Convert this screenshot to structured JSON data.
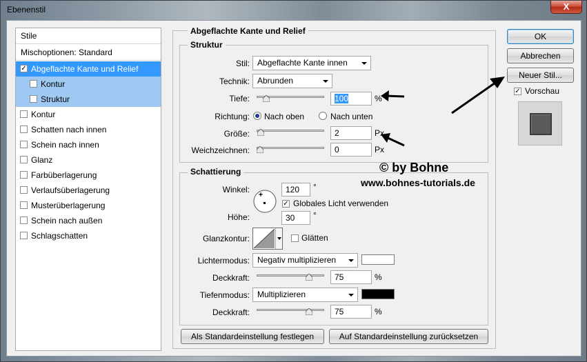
{
  "window": {
    "title": "Ebenenstil",
    "close_label": "X"
  },
  "sidebar": {
    "header": "Stile",
    "blend_options": "Mischoptionen: Standard",
    "items": [
      {
        "label": "Abgeflachte Kante und Relief",
        "checked": true,
        "selected": true
      },
      {
        "label": "Kontur",
        "checked": false,
        "sub": true
      },
      {
        "label": "Struktur",
        "checked": false,
        "sub": true
      },
      {
        "label": "Kontur",
        "checked": false
      },
      {
        "label": "Schatten nach innen",
        "checked": false
      },
      {
        "label": "Schein nach innen",
        "checked": false
      },
      {
        "label": "Glanz",
        "checked": false
      },
      {
        "label": "Farbüberlagerung",
        "checked": false
      },
      {
        "label": "Verlaufsüberlagerung",
        "checked": false
      },
      {
        "label": "Musterüberlagerung",
        "checked": false
      },
      {
        "label": "Schein nach außen",
        "checked": false
      },
      {
        "label": "Schlagschatten",
        "checked": false
      }
    ]
  },
  "panel": {
    "title": "Abgeflachte Kante und Relief",
    "structure": {
      "title": "Struktur",
      "style_label": "Stil:",
      "style_value": "Abgeflachte Kante innen",
      "technique_label": "Technik:",
      "technique_value": "Abrunden",
      "depth_label": "Tiefe:",
      "depth_value": "100",
      "depth_unit": "%",
      "depth_slider": 0.1,
      "direction_label": "Richtung:",
      "direction_up": "Nach oben",
      "direction_down": "Nach unten",
      "size_label": "Größe:",
      "size_value": "2",
      "size_unit": "Px",
      "size_slider": 0.01,
      "soften_label": "Weichzeichnen:",
      "soften_value": "0",
      "soften_unit": "Px",
      "soften_slider": 0.0
    },
    "shading": {
      "title": "Schattierung",
      "angle_label": "Winkel:",
      "angle_value": "120",
      "angle_unit": "°",
      "global_light_label": "Globales Licht verwenden",
      "global_light_checked": true,
      "altitude_label": "Höhe:",
      "altitude_value": "30",
      "altitude_unit": "°",
      "gloss_contour_label": "Glanzkontur:",
      "antialias_label": "Glätten",
      "antialias_checked": false,
      "highlight_mode_label": "Lichtermodus:",
      "highlight_mode_value": "Negativ multiplizieren",
      "highlight_color": "#ffffff",
      "highlight_opacity_label": "Deckkraft:",
      "highlight_opacity_value": "75",
      "highlight_opacity_unit": "%",
      "highlight_opacity_slider": 0.75,
      "shadow_mode_label": "Tiefenmodus:",
      "shadow_mode_value": "Multiplizieren",
      "shadow_color": "#000000",
      "shadow_opacity_label": "Deckkraft:",
      "shadow_opacity_value": "75",
      "shadow_opacity_unit": "%",
      "shadow_opacity_slider": 0.75
    },
    "make_default": "Als Standardeinstellung festlegen",
    "reset_default": "Auf Standardeinstellung zurücksetzen"
  },
  "buttons": {
    "ok": "OK",
    "cancel": "Abbrechen",
    "new_style": "Neuer Stil...",
    "preview_label": "Vorschau",
    "preview_checked": true
  },
  "watermark": {
    "line1": "© by Bohne",
    "line2": "www.bohnes-tutorials.de"
  },
  "colors": {
    "selection": "#3399ff",
    "sub_item": "#9fc8f2"
  }
}
